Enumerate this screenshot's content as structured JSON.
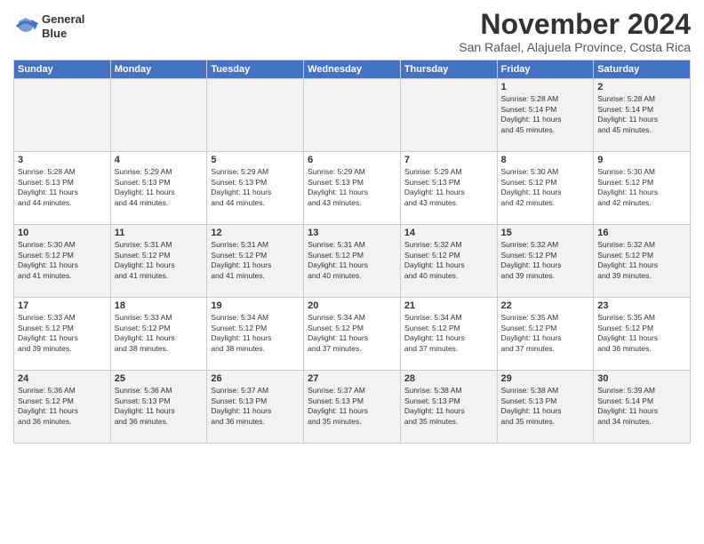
{
  "header": {
    "logo_line1": "General",
    "logo_line2": "Blue",
    "month": "November 2024",
    "location": "San Rafael, Alajuela Province, Costa Rica"
  },
  "weekdays": [
    "Sunday",
    "Monday",
    "Tuesday",
    "Wednesday",
    "Thursday",
    "Friday",
    "Saturday"
  ],
  "weeks": [
    [
      {
        "day": "",
        "info": ""
      },
      {
        "day": "",
        "info": ""
      },
      {
        "day": "",
        "info": ""
      },
      {
        "day": "",
        "info": ""
      },
      {
        "day": "",
        "info": ""
      },
      {
        "day": "1",
        "info": "Sunrise: 5:28 AM\nSunset: 5:14 PM\nDaylight: 11 hours\nand 45 minutes."
      },
      {
        "day": "2",
        "info": "Sunrise: 5:28 AM\nSunset: 5:14 PM\nDaylight: 11 hours\nand 45 minutes."
      }
    ],
    [
      {
        "day": "3",
        "info": "Sunrise: 5:28 AM\nSunset: 5:13 PM\nDaylight: 11 hours\nand 44 minutes."
      },
      {
        "day": "4",
        "info": "Sunrise: 5:29 AM\nSunset: 5:13 PM\nDaylight: 11 hours\nand 44 minutes."
      },
      {
        "day": "5",
        "info": "Sunrise: 5:29 AM\nSunset: 5:13 PM\nDaylight: 11 hours\nand 44 minutes."
      },
      {
        "day": "6",
        "info": "Sunrise: 5:29 AM\nSunset: 5:13 PM\nDaylight: 11 hours\nand 43 minutes."
      },
      {
        "day": "7",
        "info": "Sunrise: 5:29 AM\nSunset: 5:13 PM\nDaylight: 11 hours\nand 43 minutes."
      },
      {
        "day": "8",
        "info": "Sunrise: 5:30 AM\nSunset: 5:12 PM\nDaylight: 11 hours\nand 42 minutes."
      },
      {
        "day": "9",
        "info": "Sunrise: 5:30 AM\nSunset: 5:12 PM\nDaylight: 11 hours\nand 42 minutes."
      }
    ],
    [
      {
        "day": "10",
        "info": "Sunrise: 5:30 AM\nSunset: 5:12 PM\nDaylight: 11 hours\nand 41 minutes."
      },
      {
        "day": "11",
        "info": "Sunrise: 5:31 AM\nSunset: 5:12 PM\nDaylight: 11 hours\nand 41 minutes."
      },
      {
        "day": "12",
        "info": "Sunrise: 5:31 AM\nSunset: 5:12 PM\nDaylight: 11 hours\nand 41 minutes."
      },
      {
        "day": "13",
        "info": "Sunrise: 5:31 AM\nSunset: 5:12 PM\nDaylight: 11 hours\nand 40 minutes."
      },
      {
        "day": "14",
        "info": "Sunrise: 5:32 AM\nSunset: 5:12 PM\nDaylight: 11 hours\nand 40 minutes."
      },
      {
        "day": "15",
        "info": "Sunrise: 5:32 AM\nSunset: 5:12 PM\nDaylight: 11 hours\nand 39 minutes."
      },
      {
        "day": "16",
        "info": "Sunrise: 5:32 AM\nSunset: 5:12 PM\nDaylight: 11 hours\nand 39 minutes."
      }
    ],
    [
      {
        "day": "17",
        "info": "Sunrise: 5:33 AM\nSunset: 5:12 PM\nDaylight: 11 hours\nand 39 minutes."
      },
      {
        "day": "18",
        "info": "Sunrise: 5:33 AM\nSunset: 5:12 PM\nDaylight: 11 hours\nand 38 minutes."
      },
      {
        "day": "19",
        "info": "Sunrise: 5:34 AM\nSunset: 5:12 PM\nDaylight: 11 hours\nand 38 minutes."
      },
      {
        "day": "20",
        "info": "Sunrise: 5:34 AM\nSunset: 5:12 PM\nDaylight: 11 hours\nand 37 minutes."
      },
      {
        "day": "21",
        "info": "Sunrise: 5:34 AM\nSunset: 5:12 PM\nDaylight: 11 hours\nand 37 minutes."
      },
      {
        "day": "22",
        "info": "Sunrise: 5:35 AM\nSunset: 5:12 PM\nDaylight: 11 hours\nand 37 minutes."
      },
      {
        "day": "23",
        "info": "Sunrise: 5:35 AM\nSunset: 5:12 PM\nDaylight: 11 hours\nand 36 minutes."
      }
    ],
    [
      {
        "day": "24",
        "info": "Sunrise: 5:36 AM\nSunset: 5:12 PM\nDaylight: 11 hours\nand 36 minutes."
      },
      {
        "day": "25",
        "info": "Sunrise: 5:36 AM\nSunset: 5:13 PM\nDaylight: 11 hours\nand 36 minutes."
      },
      {
        "day": "26",
        "info": "Sunrise: 5:37 AM\nSunset: 5:13 PM\nDaylight: 11 hours\nand 36 minutes."
      },
      {
        "day": "27",
        "info": "Sunrise: 5:37 AM\nSunset: 5:13 PM\nDaylight: 11 hours\nand 35 minutes."
      },
      {
        "day": "28",
        "info": "Sunrise: 5:38 AM\nSunset: 5:13 PM\nDaylight: 11 hours\nand 35 minutes."
      },
      {
        "day": "29",
        "info": "Sunrise: 5:38 AM\nSunset: 5:13 PM\nDaylight: 11 hours\nand 35 minutes."
      },
      {
        "day": "30",
        "info": "Sunrise: 5:39 AM\nSunset: 5:14 PM\nDaylight: 11 hours\nand 34 minutes."
      }
    ]
  ]
}
